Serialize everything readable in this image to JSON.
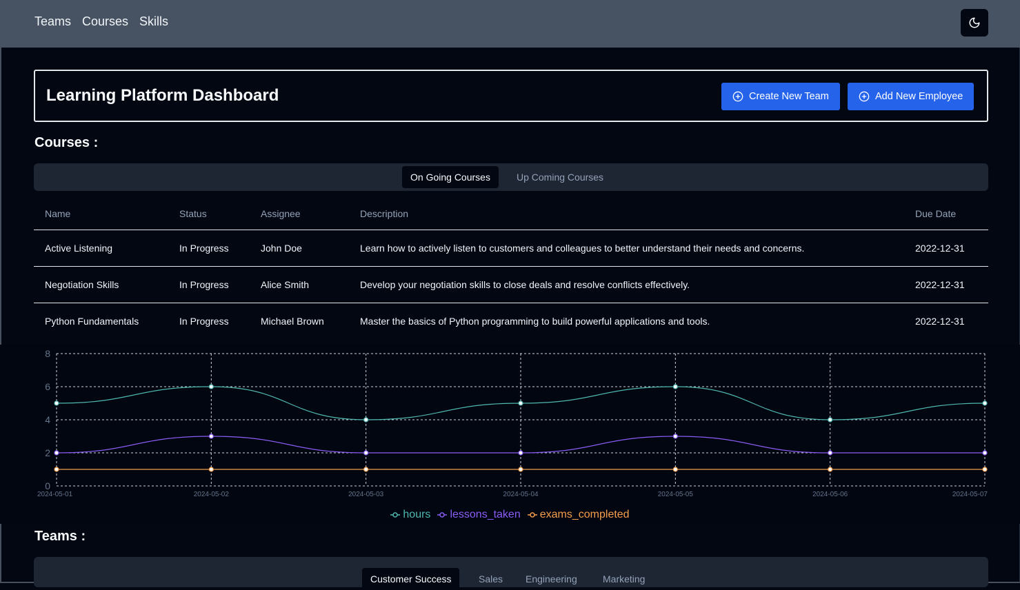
{
  "nav": {
    "items": [
      "Teams",
      "Courses",
      "Skills"
    ]
  },
  "header": {
    "title": "Learning Platform Dashboard",
    "create_team_label": "Create New Team",
    "add_employee_label": "Add New Employee"
  },
  "courses": {
    "section_title": "Courses :",
    "tabs": [
      "On Going Courses",
      "Up Coming Courses"
    ],
    "columns": [
      "Name",
      "Status",
      "Assignee",
      "Description",
      "Due Date"
    ],
    "rows": [
      [
        "Active Listening",
        "In Progress",
        "John Doe",
        "Learn how to actively listen to customers and colleagues to better understand their needs and concerns.",
        "2022-12-31"
      ],
      [
        "Negotiation Skills",
        "In Progress",
        "Alice Smith",
        "Develop your negotiation skills to close deals and resolve conflicts effectively.",
        "2022-12-31"
      ],
      [
        "Python Fundamentals",
        "In Progress",
        "Michael Brown",
        "Master the basics of Python programming to build powerful applications and tools.",
        "2022-12-31"
      ]
    ]
  },
  "teams": {
    "section_title": "Teams :",
    "tabs": [
      "Customer Success",
      "Sales",
      "Engineering",
      "Marketing"
    ]
  },
  "colors": {
    "hours": "#4fb8b0",
    "lessons_taken": "#8b5cf6",
    "exams_completed": "#f59e4b",
    "accent": "#2563eb"
  },
  "chart_data": {
    "type": "line",
    "x": [
      "2024-05-01",
      "2024-05-02",
      "2024-05-03",
      "2024-05-04",
      "2024-05-05",
      "2024-05-06",
      "2024-05-07"
    ],
    "ylim": [
      0,
      8
    ],
    "yticks": [
      0,
      2,
      4,
      6,
      8
    ],
    "grid": true,
    "legend": "bottom-center",
    "series": [
      {
        "name": "hours",
        "values": [
          5,
          6,
          4,
          5,
          6,
          4,
          5
        ]
      },
      {
        "name": "lessons_taken",
        "values": [
          2,
          3,
          2,
          2,
          3,
          2,
          2
        ]
      },
      {
        "name": "exams_completed",
        "values": [
          1,
          1,
          1,
          1,
          1,
          1,
          1
        ]
      }
    ]
  }
}
